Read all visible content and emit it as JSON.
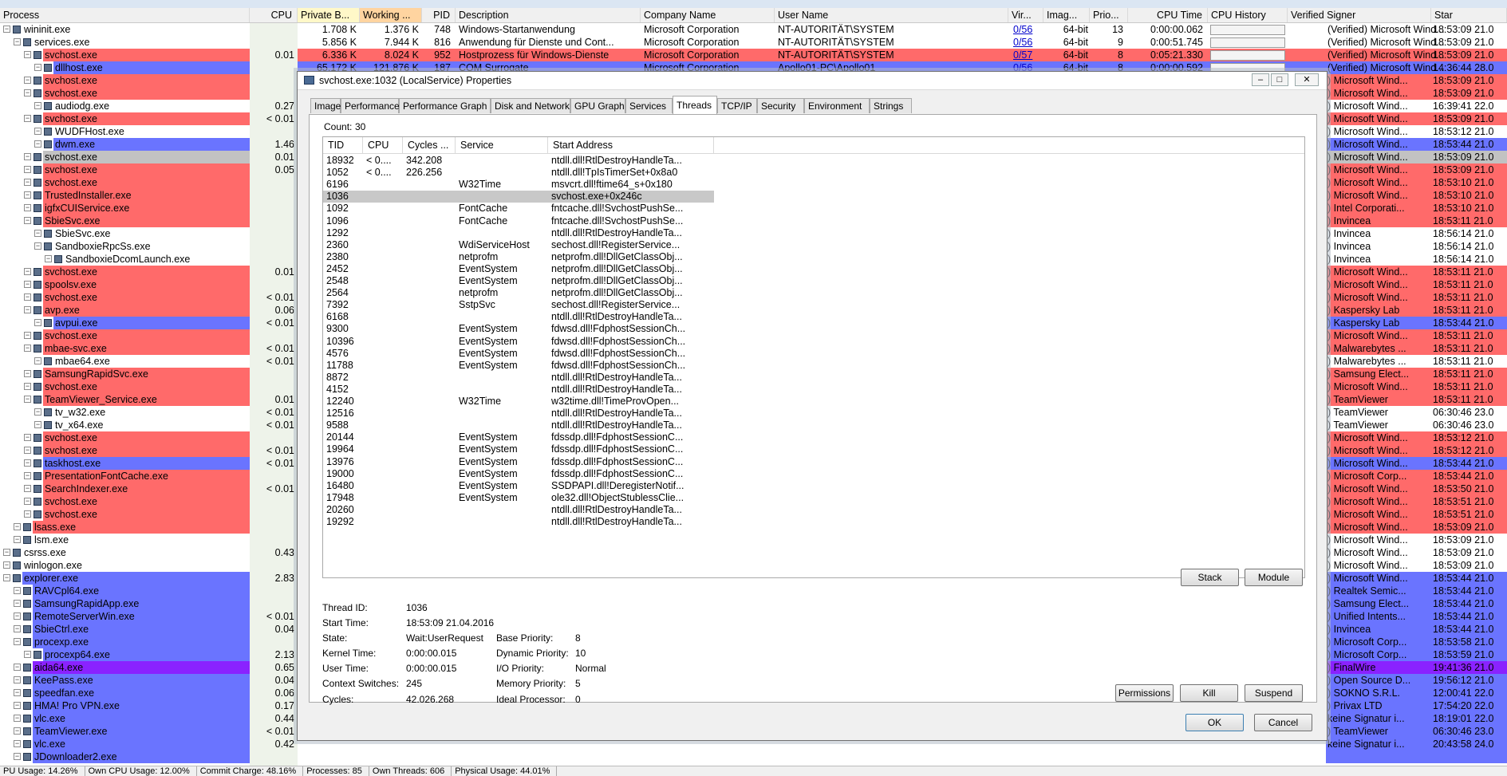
{
  "header": {
    "columns": [
      "Process",
      "CPU",
      "Private B...",
      "Working ...",
      "PID",
      "Description",
      "Company Name",
      "User Name",
      "Vir...",
      "Imag...",
      "Prio...",
      "CPU Time",
      "CPU History",
      "Verified Signer",
      "Star"
    ]
  },
  "processes": [
    {
      "name": "wininit.exe",
      "indent": 0,
      "bg": "#ffffff",
      "cpu": "",
      "private": "1.708 K",
      "working": "1.376 K",
      "pid": "748",
      "desc": "Windows-Startanwendung",
      "company": "Microsoft Corporation",
      "user": "NT-AUTORITÄT\\SYSTEM",
      "vir": "0/56",
      "img": "64-bit",
      "prio": "13",
      "cputime": "0:00:00.062",
      "signer": "(Verified) Microsoft Wind...",
      "start": "18:53:09 21.0"
    },
    {
      "name": "services.exe",
      "indent": 1,
      "bg": "#ffffff",
      "cpu": "",
      "private": "5.856 K",
      "working": "7.944 K",
      "pid": "816",
      "desc": "Anwendung für Dienste und Cont...",
      "company": "Microsoft Corporation",
      "user": "NT-AUTORITÄT\\SYSTEM",
      "vir": "0/56",
      "img": "64-bit",
      "prio": "9",
      "cputime": "0:00:51.745",
      "signer": "(Verified) Microsoft Wind...",
      "start": "18:53:09 21.0"
    },
    {
      "name": "svchost.exe",
      "indent": 2,
      "bg": "#ff6a6a",
      "cpu": "0.01",
      "private": "6.336 K",
      "working": "8.024 K",
      "pid": "952",
      "desc": "Hostprozess für Windows-Dienste",
      "company": "Microsoft Corporation",
      "user": "NT-AUTORITÄT\\SYSTEM",
      "vir": "0/57",
      "img": "64-bit",
      "prio": "8",
      "cputime": "0:05:21.330",
      "signer": "(Verified) Microsoft Wind...",
      "start": "18:53:09 21.0"
    },
    {
      "name": "dllhost.exe",
      "indent": 3,
      "bg": "#6a74ff",
      "cpu": "",
      "private": "65.172 K",
      "working": "121.876 K",
      "pid": "187",
      "desc": "COM Surrogate",
      "company": "Microsoft Corporation",
      "user": "Apollo01-PC\\Apollo01",
      "vir": "0/56",
      "img": "64-bit",
      "prio": "8",
      "cputime": "0:00:00.592",
      "signer": "(Verified) Microsoft Wind...",
      "start": "14:36:44 28.0"
    },
    {
      "name": "svchost.exe",
      "indent": 2,
      "bg": "#ff6a6a",
      "cpu": "",
      "signer": ") Microsoft Wind...",
      "start": "18:53:09 21.0"
    },
    {
      "name": "svchost.exe",
      "indent": 2,
      "bg": "#ff6a6a",
      "cpu": "",
      "signer": ") Microsoft Wind...",
      "start": "18:53:09 21.0"
    },
    {
      "name": "audiodg.exe",
      "indent": 3,
      "bg": "#ffffff",
      "cpu": "0.27",
      "signer": ") Microsoft Wind...",
      "start": "16:39:41 22.0"
    },
    {
      "name": "svchost.exe",
      "indent": 2,
      "bg": "#ff6a6a",
      "cpu": "< 0.01",
      "signer": ") Microsoft Wind...",
      "start": "18:53:09 21.0"
    },
    {
      "name": "WUDFHost.exe",
      "indent": 3,
      "bg": "#ffffff",
      "cpu": "",
      "signer": ") Microsoft Wind...",
      "start": "18:53:12 21.0"
    },
    {
      "name": "dwm.exe",
      "indent": 3,
      "bg": "#6a74ff",
      "cpu": "1.46",
      "signer": ") Microsoft Wind...",
      "start": "18:53:44 21.0"
    },
    {
      "name": "svchost.exe",
      "indent": 2,
      "bg": "#c2c2c2",
      "cpu": "0.01",
      "signer": ") Microsoft Wind...",
      "start": "18:53:09 21.0"
    },
    {
      "name": "svchost.exe",
      "indent": 2,
      "bg": "#ff6a6a",
      "cpu": "0.05",
      "signer": ") Microsoft Wind...",
      "start": "18:53:09 21.0"
    },
    {
      "name": "svchost.exe",
      "indent": 2,
      "bg": "#ff6a6a",
      "cpu": "",
      "signer": ") Microsoft Wind...",
      "start": "18:53:10 21.0"
    },
    {
      "name": "TrustedInstaller.exe",
      "indent": 2,
      "bg": "#ff6a6a",
      "cpu": "",
      "signer": ") Microsoft Wind...",
      "start": "18:53:10 21.0"
    },
    {
      "name": "igfxCUIService.exe",
      "indent": 2,
      "bg": "#ff6a6a",
      "cpu": "",
      "signer": ") Intel Corporati...",
      "start": "18:53:10 21.0"
    },
    {
      "name": "SbieSvc.exe",
      "indent": 2,
      "bg": "#ff6a6a",
      "cpu": "",
      "signer": ") Invincea",
      "start": "18:53:11 21.0"
    },
    {
      "name": "SbieSvc.exe",
      "indent": 3,
      "bg": "#ffffff",
      "cpu": "",
      "signer": ") Invincea",
      "start": "18:56:14 21.0"
    },
    {
      "name": "SandboxieRpcSs.exe",
      "indent": 3,
      "bg": "#ffffff",
      "cpu": "",
      "signer": ") Invincea",
      "start": "18:56:14 21.0"
    },
    {
      "name": "SandboxieDcomLaunch.exe",
      "indent": 4,
      "bg": "#ffffff",
      "cpu": "",
      "signer": ") Invincea",
      "start": "18:56:14 21.0"
    },
    {
      "name": "svchost.exe",
      "indent": 2,
      "bg": "#ff6a6a",
      "cpu": "0.01",
      "signer": ") Microsoft Wind...",
      "start": "18:53:11 21.0"
    },
    {
      "name": "spoolsv.exe",
      "indent": 2,
      "bg": "#ff6a6a",
      "cpu": "",
      "signer": ") Microsoft Wind...",
      "start": "18:53:11 21.0"
    },
    {
      "name": "svchost.exe",
      "indent": 2,
      "bg": "#ff6a6a",
      "cpu": "< 0.01",
      "signer": ") Microsoft Wind...",
      "start": "18:53:11 21.0"
    },
    {
      "name": "avp.exe",
      "indent": 2,
      "bg": "#ff6a6a",
      "cpu": "0.06",
      "signer": ") Kaspersky Lab",
      "start": "18:53:11 21.0"
    },
    {
      "name": "avpui.exe",
      "indent": 3,
      "bg": "#6a74ff",
      "cpu": "< 0.01",
      "signer": ") Kaspersky Lab",
      "start": "18:53:44 21.0"
    },
    {
      "name": "svchost.exe",
      "indent": 2,
      "bg": "#ff6a6a",
      "cpu": "",
      "signer": ") Microsoft Wind...",
      "start": "18:53:11 21.0"
    },
    {
      "name": "mbae-svc.exe",
      "indent": 2,
      "bg": "#ff6a6a",
      "cpu": "< 0.01",
      "signer": ") Malwarebytes ...",
      "start": "18:53:11 21.0"
    },
    {
      "name": "mbae64.exe",
      "indent": 3,
      "bg": "#ffffff",
      "cpu": "< 0.01",
      "signer": ") Malwarebytes ...",
      "start": "18:53:11 21.0"
    },
    {
      "name": "SamsungRapidSvc.exe",
      "indent": 2,
      "bg": "#ff6a6a",
      "cpu": "",
      "signer": ") Samsung Elect...",
      "start": "18:53:11 21.0"
    },
    {
      "name": "svchost.exe",
      "indent": 2,
      "bg": "#ff6a6a",
      "cpu": "",
      "signer": ") Microsoft Wind...",
      "start": "18:53:11 21.0"
    },
    {
      "name": "TeamViewer_Service.exe",
      "indent": 2,
      "bg": "#ff6a6a",
      "cpu": "0.01",
      "signer": ") TeamViewer",
      "start": "18:53:11 21.0"
    },
    {
      "name": "tv_w32.exe",
      "indent": 3,
      "bg": "#ffffff",
      "cpu": "< 0.01",
      "signer": ") TeamViewer",
      "start": "06:30:46 23.0"
    },
    {
      "name": "tv_x64.exe",
      "indent": 3,
      "bg": "#ffffff",
      "cpu": "< 0.01",
      "signer": ") TeamViewer",
      "start": "06:30:46 23.0"
    },
    {
      "name": "svchost.exe",
      "indent": 2,
      "bg": "#ff6a6a",
      "cpu": "",
      "signer": ") Microsoft Wind...",
      "start": "18:53:12 21.0"
    },
    {
      "name": "svchost.exe",
      "indent": 2,
      "bg": "#ff6a6a",
      "cpu": "< 0.01",
      "signer": ") Microsoft Wind...",
      "start": "18:53:12 21.0"
    },
    {
      "name": "taskhost.exe",
      "indent": 2,
      "bg": "#6a74ff",
      "cpu": "< 0.01",
      "signer": ") Microsoft Wind...",
      "start": "18:53:44 21.0"
    },
    {
      "name": "PresentationFontCache.exe",
      "indent": 2,
      "bg": "#ff6a6a",
      "cpu": "",
      "signer": ") Microsoft Corp...",
      "start": "18:53:44 21.0"
    },
    {
      "name": "SearchIndexer.exe",
      "indent": 2,
      "bg": "#ff6a6a",
      "cpu": "< 0.01",
      "signer": ") Microsoft Wind...",
      "start": "18:53:50 21.0"
    },
    {
      "name": "svchost.exe",
      "indent": 2,
      "bg": "#ff6a6a",
      "cpu": "",
      "signer": ") Microsoft Wind...",
      "start": "18:53:51 21.0"
    },
    {
      "name": "svchost.exe",
      "indent": 2,
      "bg": "#ff6a6a",
      "cpu": "",
      "signer": ") Microsoft Wind...",
      "start": "18:53:51 21.0"
    },
    {
      "name": "lsass.exe",
      "indent": 1,
      "bg": "#ff6a6a",
      "cpu": "",
      "signer": ") Microsoft Wind...",
      "start": "18:53:09 21.0"
    },
    {
      "name": "lsm.exe",
      "indent": 1,
      "bg": "#ffffff",
      "cpu": "",
      "signer": ") Microsoft Wind...",
      "start": "18:53:09 21.0"
    },
    {
      "name": "csrss.exe",
      "indent": 0,
      "bg": "#ffffff",
      "cpu": "0.43",
      "signer": ") Microsoft Wind...",
      "start": "18:53:09 21.0"
    },
    {
      "name": "winlogon.exe",
      "indent": 0,
      "bg": "#ffffff",
      "cpu": "",
      "signer": ") Microsoft Wind...",
      "start": "18:53:09 21.0"
    },
    {
      "name": "explorer.exe",
      "indent": 0,
      "bg": "#6a74ff",
      "cpu": "2.83",
      "signer": ") Microsoft Wind...",
      "start": "18:53:44 21.0"
    },
    {
      "name": "RAVCpl64.exe",
      "indent": 1,
      "bg": "#6a74ff",
      "cpu": "",
      "signer": ") Realtek Semic...",
      "start": "18:53:44 21.0"
    },
    {
      "name": "SamsungRapidApp.exe",
      "indent": 1,
      "bg": "#6a74ff",
      "cpu": "",
      "signer": ") Samsung Elect...",
      "start": "18:53:44 21.0"
    },
    {
      "name": "RemoteServerWin.exe",
      "indent": 1,
      "bg": "#6a74ff",
      "cpu": "< 0.01",
      "signer": ") Unified Intents...",
      "start": "18:53:44 21.0"
    },
    {
      "name": "SbieCtrl.exe",
      "indent": 1,
      "bg": "#6a74ff",
      "cpu": "0.04",
      "signer": ") Invincea",
      "start": "18:53:44 21.0"
    },
    {
      "name": "procexp.exe",
      "indent": 1,
      "bg": "#6a74ff",
      "cpu": "",
      "signer": ") Microsoft Corp...",
      "start": "18:53:58 21.0"
    },
    {
      "name": "procexp64.exe",
      "indent": 2,
      "bg": "#6a74ff",
      "cpu": "2.13",
      "signer": ") Microsoft Corp...",
      "start": "18:53:59 21.0"
    },
    {
      "name": "aida64.exe",
      "indent": 1,
      "bg": "#8a22ff",
      "cpu": "0.65",
      "signer": ") FinalWire",
      "start": "19:41:36 21.0"
    },
    {
      "name": "KeePass.exe",
      "indent": 1,
      "bg": "#6a74ff",
      "cpu": "0.04",
      "signer": ") Open Source D...",
      "start": "19:56:12 21.0"
    },
    {
      "name": "speedfan.exe",
      "indent": 1,
      "bg": "#6a74ff",
      "cpu": "0.06",
      "signer": ") SOKNO S.R.L.",
      "start": "12:00:41 22.0"
    },
    {
      "name": "HMA! Pro VPN.exe",
      "indent": 1,
      "bg": "#6a74ff",
      "cpu": "0.17",
      "signer": ") Privax LTD",
      "start": "17:54:20 22.0"
    },
    {
      "name": "vlc.exe",
      "indent": 1,
      "bg": "#6a74ff",
      "cpu": "0.44",
      "signer": "keine Signatur i...",
      "start": "18:19:01 22.0"
    },
    {
      "name": "TeamViewer.exe",
      "indent": 1,
      "bg": "#6a74ff",
      "cpu": "< 0.01",
      "signer": ") TeamViewer",
      "start": "06:30:46 23.0"
    },
    {
      "name": "vlc.exe",
      "indent": 1,
      "bg": "#6a74ff",
      "cpu": "0.42",
      "signer": "keine Signatur i...",
      "start": "20:43:58 24.0"
    },
    {
      "name": "JDownloader2.exe",
      "indent": 1,
      "bg": "#6a74ff",
      "cpu": "",
      "signer": "",
      "start": ""
    }
  ],
  "statusbar": [
    "PU Usage: 14.26%",
    "Own CPU Usage: 12.00%",
    "Commit Charge: 48.16%",
    "Processes: 85",
    "Own Threads: 606",
    "Physical Usage: 44.01%"
  ],
  "dialog": {
    "title": "svchost.exe:1032 (LocalService) Properties",
    "tabs": [
      "Image",
      "Performance",
      "Performance Graph",
      "Disk and Network",
      "GPU Graph",
      "Services",
      "Threads",
      "TCP/IP",
      "Security",
      "Environment",
      "Strings"
    ],
    "active_tab": "Threads",
    "count_label": "Count:",
    "count_value": "30",
    "thread_columns": [
      "TID",
      "CPU",
      "Cycles ...",
      "Service",
      "Start Address"
    ],
    "threads": [
      {
        "tid": "18932",
        "cpu": "< 0....",
        "cycles": "342.208",
        "service": "",
        "addr": "ntdll.dll!RtlDestroyHandleTa..."
      },
      {
        "tid": "1052",
        "cpu": "< 0....",
        "cycles": "226.256",
        "service": "",
        "addr": "ntdll.dll!TpIsTimerSet+0x8a0"
      },
      {
        "tid": "6196",
        "cpu": "",
        "cycles": "",
        "service": "W32Time",
        "addr": "msvcrt.dll!ftime64_s+0x180"
      },
      {
        "tid": "1036",
        "cpu": "",
        "cycles": "",
        "service": "",
        "addr": "svchost.exe+0x246c"
      },
      {
        "tid": "1092",
        "cpu": "",
        "cycles": "",
        "service": "FontCache",
        "addr": "fntcache.dll!SvchostPushSe..."
      },
      {
        "tid": "1096",
        "cpu": "",
        "cycles": "",
        "service": "FontCache",
        "addr": "fntcache.dll!SvchostPushSe..."
      },
      {
        "tid": "1292",
        "cpu": "",
        "cycles": "",
        "service": "",
        "addr": "ntdll.dll!RtlDestroyHandleTa..."
      },
      {
        "tid": "2360",
        "cpu": "",
        "cycles": "",
        "service": "WdiServiceHost",
        "addr": "sechost.dll!RegisterService..."
      },
      {
        "tid": "2380",
        "cpu": "",
        "cycles": "",
        "service": "netprofm",
        "addr": "netprofm.dll!DllGetClassObj..."
      },
      {
        "tid": "2452",
        "cpu": "",
        "cycles": "",
        "service": "EventSystem",
        "addr": "netprofm.dll!DllGetClassObj..."
      },
      {
        "tid": "2548",
        "cpu": "",
        "cycles": "",
        "service": "EventSystem",
        "addr": "netprofm.dll!DllGetClassObj..."
      },
      {
        "tid": "2564",
        "cpu": "",
        "cycles": "",
        "service": "netprofm",
        "addr": "netprofm.dll!DllGetClassObj..."
      },
      {
        "tid": "7392",
        "cpu": "",
        "cycles": "",
        "service": "SstpSvc",
        "addr": "sechost.dll!RegisterService..."
      },
      {
        "tid": "6168",
        "cpu": "",
        "cycles": "",
        "service": "",
        "addr": "ntdll.dll!RtlDestroyHandleTa..."
      },
      {
        "tid": "9300",
        "cpu": "",
        "cycles": "",
        "service": "EventSystem",
        "addr": "fdwsd.dll!FdphostSessionCh..."
      },
      {
        "tid": "10396",
        "cpu": "",
        "cycles": "",
        "service": "EventSystem",
        "addr": "fdwsd.dll!FdphostSessionCh..."
      },
      {
        "tid": "4576",
        "cpu": "",
        "cycles": "",
        "service": "EventSystem",
        "addr": "fdwsd.dll!FdphostSessionCh..."
      },
      {
        "tid": "11788",
        "cpu": "",
        "cycles": "",
        "service": "EventSystem",
        "addr": "fdwsd.dll!FdphostSessionCh..."
      },
      {
        "tid": "8872",
        "cpu": "",
        "cycles": "",
        "service": "",
        "addr": "ntdll.dll!RtlDestroyHandleTa..."
      },
      {
        "tid": "4152",
        "cpu": "",
        "cycles": "",
        "service": "",
        "addr": "ntdll.dll!RtlDestroyHandleTa..."
      },
      {
        "tid": "12240",
        "cpu": "",
        "cycles": "",
        "service": "W32Time",
        "addr": "w32time.dll!TimeProvOpen..."
      },
      {
        "tid": "12516",
        "cpu": "",
        "cycles": "",
        "service": "",
        "addr": "ntdll.dll!RtlDestroyHandleTa..."
      },
      {
        "tid": "9588",
        "cpu": "",
        "cycles": "",
        "service": "",
        "addr": "ntdll.dll!RtlDestroyHandleTa..."
      },
      {
        "tid": "20144",
        "cpu": "",
        "cycles": "",
        "service": "EventSystem",
        "addr": "fdssdp.dll!FdphostSessionC..."
      },
      {
        "tid": "19964",
        "cpu": "",
        "cycles": "",
        "service": "EventSystem",
        "addr": "fdssdp.dll!FdphostSessionC..."
      },
      {
        "tid": "13976",
        "cpu": "",
        "cycles": "",
        "service": "EventSystem",
        "addr": "fdssdp.dll!FdphostSessionC..."
      },
      {
        "tid": "19000",
        "cpu": "",
        "cycles": "",
        "service": "EventSystem",
        "addr": "fdssdp.dll!FdphostSessionC..."
      },
      {
        "tid": "16480",
        "cpu": "",
        "cycles": "",
        "service": "EventSystem",
        "addr": "SSDPAPI.dll!DeregisterNotif..."
      },
      {
        "tid": "17948",
        "cpu": "",
        "cycles": "",
        "service": "EventSystem",
        "addr": "ole32.dll!ObjectStublessClie..."
      },
      {
        "tid": "20260",
        "cpu": "",
        "cycles": "",
        "service": "",
        "addr": "ntdll.dll!RtlDestroyHandleTa..."
      },
      {
        "tid": "19292",
        "cpu": "",
        "cycles": "",
        "service": "",
        "addr": "ntdll.dll!RtlDestroyHandleTa..."
      }
    ],
    "selected_index": 3,
    "info": {
      "thread_id_label": "Thread ID:",
      "thread_id": "1036",
      "start_time_label": "Start Time:",
      "start_time": "18:53:09   21.04.2016",
      "state_label": "State:",
      "state": "Wait:UserRequest",
      "base_priority_label": "Base Priority:",
      "base_priority": "8",
      "kernel_time_label": "Kernel Time:",
      "kernel_time": "0:00:00.015",
      "dynamic_priority_label": "Dynamic Priority:",
      "dynamic_priority": "10",
      "user_time_label": "User Time:",
      "user_time": "0:00:00.015",
      "io_priority_label": "I/O Priority:",
      "io_priority": "Normal",
      "context_switches_label": "Context Switches:",
      "context_switches": "245",
      "memory_priority_label": "Memory Priority:",
      "memory_priority": "5",
      "cycles_label": "Cycles:",
      "cycles": "42.026.268",
      "ideal_processor_label": "Ideal Processor:",
      "ideal_processor": "0"
    },
    "buttons": {
      "stack": "Stack",
      "module": "Module",
      "permissions": "Permissions",
      "kill": "Kill",
      "suspend": "Suspend",
      "ok": "OK",
      "cancel": "Cancel"
    },
    "win_buttons": {
      "minimize": "‒",
      "maximize": "□",
      "close": "✕"
    }
  }
}
